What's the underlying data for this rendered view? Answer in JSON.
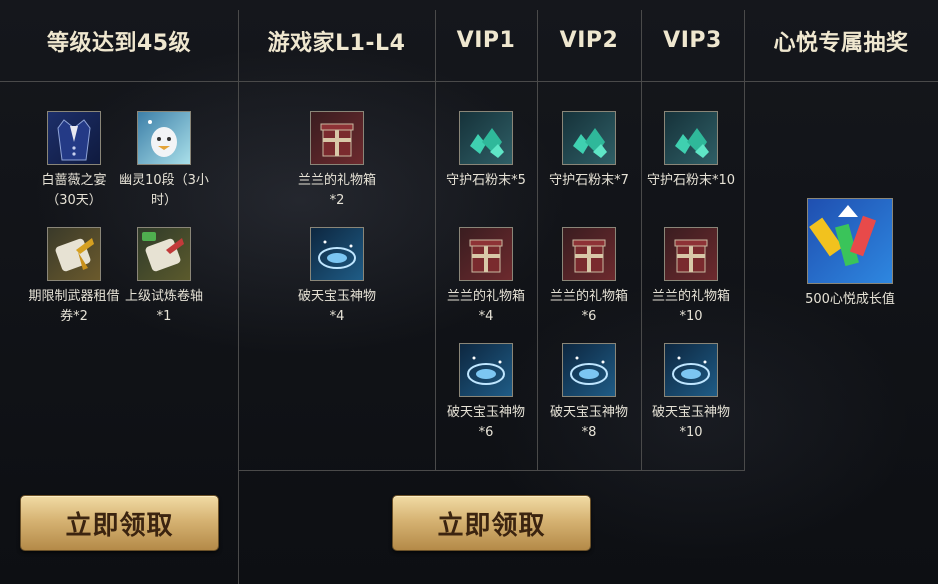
{
  "headers": {
    "level": "等级达到45级",
    "player": "游戏家L1-L4",
    "vip1": "VIP1",
    "vip2": "VIP2",
    "vip3": "VIP3",
    "lottery": "心悦专属抽奖"
  },
  "level_rewards": [
    {
      "label": "白蔷薇之宴（30天）",
      "icon": "suit-icon"
    },
    {
      "label": "幽灵10段（3小时）",
      "icon": "ghost-pet-icon"
    },
    {
      "label": "期限制武器租借券*2",
      "icon": "scroll-coupon-icon"
    },
    {
      "label": "上级试炼卷轴*1",
      "icon": "trial-scroll-icon"
    }
  ],
  "player_rewards": [
    {
      "label": "兰兰的礼物箱*2",
      "icon": "gift-box-icon"
    },
    {
      "label": "破天宝玉神物*4",
      "icon": "jade-icon"
    }
  ],
  "vip1_rewards": [
    {
      "label": "守护石粉末*5",
      "icon": "gem-powder-icon"
    },
    {
      "label": "兰兰的礼物箱*4",
      "icon": "gift-box-icon"
    },
    {
      "label": "破天宝玉神物*6",
      "icon": "jade-icon"
    }
  ],
  "vip2_rewards": [
    {
      "label": "守护石粉末*7",
      "icon": "gem-powder-icon"
    },
    {
      "label": "兰兰的礼物箱*6",
      "icon": "gift-box-icon"
    },
    {
      "label": "破天宝玉神物*8",
      "icon": "jade-icon"
    }
  ],
  "vip3_rewards": [
    {
      "label": "守护石粉末*10",
      "icon": "gem-powder-icon"
    },
    {
      "label": "兰兰的礼物箱*10",
      "icon": "gift-box-icon"
    },
    {
      "label": "破天宝玉神物*10",
      "icon": "jade-icon"
    }
  ],
  "lottery_rewards": [
    {
      "label": "500心悦成长值",
      "icon": "vip-growth-icon"
    }
  ],
  "buttons": {
    "claim_level": "立即领取",
    "claim_vip": "立即领取"
  },
  "colors": {
    "accent_gold": "#d6b373",
    "grid_line": "#4a4a4a"
  }
}
